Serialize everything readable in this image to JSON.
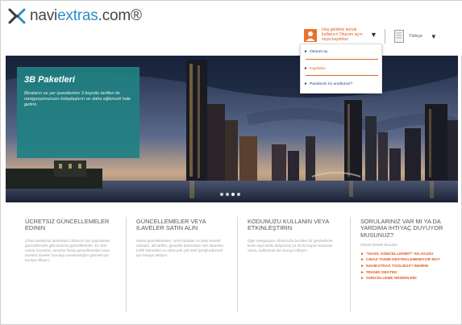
{
  "header": {
    "logo_text_dark": "navi",
    "logo_text_accent": "extras",
    "logo_text_suffix": ".com®",
    "user_text": "Hoş geldiniz konuk kullanıcı! Oturum açın veya kaydolun",
    "lang_label": "Türkçe"
  },
  "dropdown": {
    "items": [
      {
        "label": "Oturum aç",
        "color": "#1a3a8c"
      },
      {
        "label": "Kaydolun",
        "color": "#e05a1a"
      },
      {
        "label": "Parolanızı mı unuttunuz?",
        "color": "#1a3a8c"
      }
    ]
  },
  "hero": {
    "title": "3B Paketleri",
    "text": "Binaların ve yer işaretlerinin 3 boyutlu tarifleri ile navigasyonunuzu kolaylaştırın ve daha eğlenceli hale getirin.",
    "slides_total": 4,
    "active_slide": 3
  },
  "columns": [
    {
      "title": "Ücretsiz güncellemeler edinin",
      "text": "Cihaz üreticinizi tarafından cihazınız için yayınlanan güncellemeler gibi ücretsiz güncellemeler, En Son Harita Garantisi, ücretsiz harita güncellemeleri veya ücretsiz ilaveler sunulup sunulmadığını görmek için buraya tıklayın."
    },
    {
      "title": "Güncellemeler veya ilaveler satın alın",
      "text": "Harita güncellemeleri, sesli haritalar ve ilave önemli noktalar, 3B tarifler, güvenlik kameraları veri tabanları, trafik hizmetleri ve daha pek çok özel içeriği edinmek için buraya tıklayın."
    },
    {
      "title": "Kodunuzu kullanın veya etkinleştirin",
      "text": "Eğer navigasyon cihazınızla beraber bir güncelleme kodu veya kodu aldıysanız ya da bir kupon kodunuz varsa, kullanmak için buraya tıklayın."
    },
    {
      "title": "Sorularınız var mı ya da yardıma ihtiyaç duyuyor musunuz?",
      "text": "Öneml destek konuları:",
      "links": [
        "\"Nasıl güncellerim?\" kılavuzu",
        "Cihaz tanım desteklenemiyor mu?",
        "Naviextras Toolbox'ı indirin",
        "Teknik destek",
        "Güncelleme nedenleri"
      ]
    }
  ],
  "colors": {
    "accent": "#e05a1a",
    "brand_blue": "#2d8fc7",
    "promo_teal": "#208082"
  }
}
